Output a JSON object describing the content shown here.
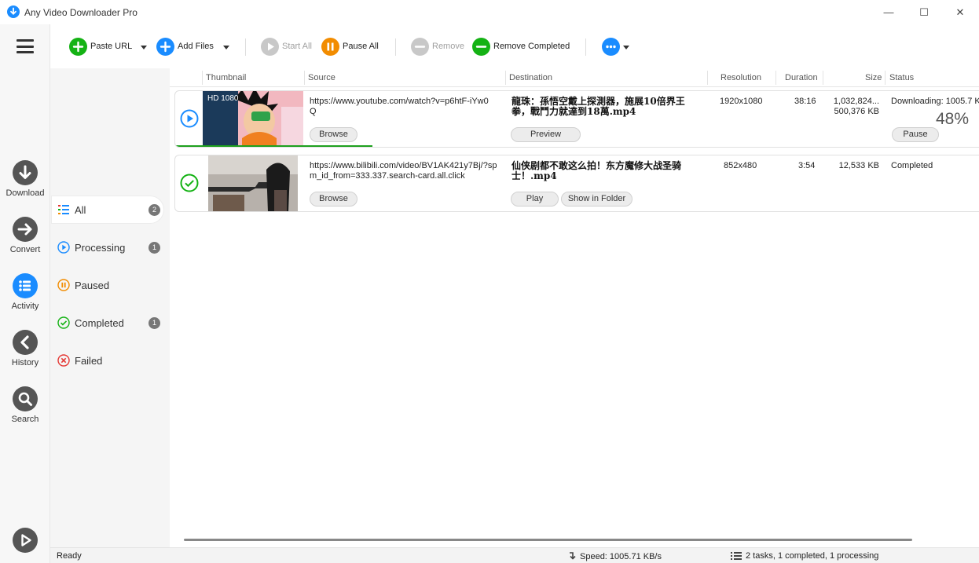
{
  "window": {
    "title": "Any Video Downloader Pro",
    "controls": {
      "minimize": "—",
      "maximize": "☐",
      "close": "✕"
    }
  },
  "toolbar": {
    "paste_url": "Paste URL",
    "add_files": "Add Files",
    "start_all": "Start All",
    "pause_all": "Pause All",
    "remove": "Remove",
    "remove_completed": "Remove Completed"
  },
  "nav": {
    "items": [
      {
        "label": "Download",
        "icon": "download-arrow-icon"
      },
      {
        "label": "Convert",
        "icon": "convert-arrow-icon"
      },
      {
        "label": "Activity",
        "icon": "list-icon"
      },
      {
        "label": "History",
        "icon": "back-chevron-icon"
      },
      {
        "label": "Search",
        "icon": "magnifier-icon"
      }
    ]
  },
  "filters": {
    "items": [
      {
        "label": "All",
        "count": "2"
      },
      {
        "label": "Processing",
        "count": "1"
      },
      {
        "label": "Paused",
        "count": ""
      },
      {
        "label": "Completed",
        "count": "1"
      },
      {
        "label": "Failed",
        "count": ""
      }
    ]
  },
  "columns": {
    "thumbnail": "Thumbnail",
    "source": "Source",
    "destination": "Destination",
    "resolution": "Resolution",
    "duration": "Duration",
    "size": "Size",
    "status": "Status"
  },
  "rows": [
    {
      "thumb_badge": "HD 1080",
      "source_line1": "https://www.youtube.com/watch?v=p6htF-iYw0",
      "source_line2": "Q",
      "browse": "Browse",
      "dest_line1": "龍珠：孫悟空戴上探測器，施展10倍界王",
      "dest_line2": "拳，戰鬥力就達到18萬.mp4",
      "action1": "Preview",
      "resolution": "1920x1080",
      "duration": "38:16",
      "size_line1": "1,032,824...",
      "size_line2": "500,376 KB",
      "status": "Downloading: 1005.7 K",
      "percent": "48%",
      "status_action": "Pause",
      "progress": 0.48,
      "accent": "#1ea01e"
    },
    {
      "source_line1": "https://www.bilibili.com/video/BV1AK421y7Bj/?sp",
      "source_line2": "m_id_from=333.337.search-card.all.click",
      "browse": "Browse",
      "dest_line1": "仙侠剧都不敢这么拍！东方魔修大战圣骑",
      "dest_line2": "士！.mp4",
      "action1": "Play",
      "action2": "Show in Folder",
      "resolution": "852x480",
      "duration": "3:54",
      "size": "12,533 KB",
      "status": "Completed"
    }
  ],
  "status": {
    "ready": "Ready",
    "speed": "Speed: 1005.71 KB/s",
    "tasks": "2 tasks, 1 completed, 1 processing"
  },
  "colors": {
    "accent": "#1a8cff",
    "green": "#14b214",
    "orange": "#f28c00",
    "red": "#e53935"
  }
}
